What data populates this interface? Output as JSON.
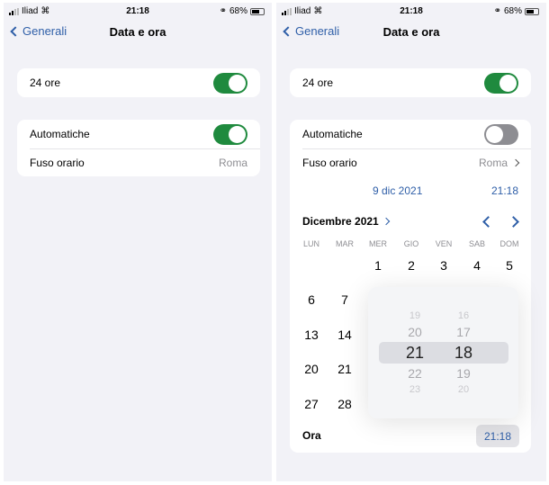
{
  "colors": {
    "accent": "#2f5fa8",
    "toggle_on": "#1f8a3e",
    "toggle_off": "#8d8d92",
    "background": "#f2f2f7"
  },
  "screens": [
    {
      "status": {
        "carrier": "Iliad",
        "time": "21:18",
        "battery": "68%"
      },
      "nav": {
        "back_label": "Generali",
        "title": "Data e ora"
      },
      "h24": {
        "label": "24 ore",
        "on": true
      },
      "auto": {
        "label": "Automatiche",
        "on": true
      },
      "timezone": {
        "label": "Fuso orario",
        "value": "Roma"
      }
    },
    {
      "status": {
        "carrier": "Iliad",
        "time": "21:18",
        "battery": "68%"
      },
      "nav": {
        "back_label": "Generali",
        "title": "Data e ora"
      },
      "h24": {
        "label": "24 ore",
        "on": true
      },
      "auto": {
        "label": "Automatiche",
        "on": false
      },
      "timezone": {
        "label": "Fuso orario",
        "value": "Roma"
      },
      "date": "9 dic 2021",
      "time": "21:18",
      "calendar": {
        "month": "Dicembre 2021",
        "weekdays": [
          "LUN",
          "MAR",
          "MER",
          "GIO",
          "VEN",
          "SAB",
          "DOM"
        ],
        "week1": [
          "1",
          "2",
          "3",
          "4",
          "5"
        ],
        "visible_days": [
          [
            "6",
            "7"
          ],
          [
            "13",
            "14"
          ],
          [
            "20",
            "21"
          ],
          [
            "27",
            "28"
          ]
        ]
      },
      "picker": {
        "hours": [
          "19",
          "20",
          "21",
          "22",
          "23"
        ],
        "minutes": [
          "16",
          "17",
          "18",
          "19",
          "20"
        ],
        "selected_hour": "21",
        "selected_minute": "18"
      },
      "ora": {
        "label": "Ora",
        "value": "21:18"
      }
    }
  ]
}
